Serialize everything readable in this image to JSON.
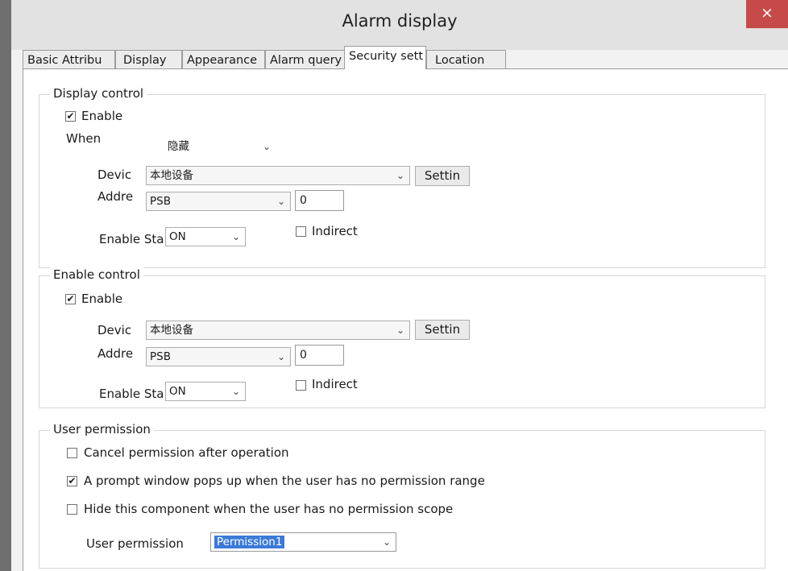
{
  "window": {
    "title": "Alarm display",
    "close_glyph": "×"
  },
  "tabs": [
    "Basic Attribu",
    "Display",
    "Appearance",
    "Alarm query",
    "Security sett",
    "Location"
  ],
  "display_control": {
    "legend": "Display control",
    "enable_label": "Enable",
    "enable_checked": true,
    "when_label": "When",
    "when_value": "隐藏",
    "device_label": "Devic",
    "device_value": "本地设备",
    "settings_button": "Settin",
    "address_label": "Addre",
    "address_type": "PSB",
    "address_value": "0",
    "enable_state_label": "Enable Sta",
    "enable_state_value": "ON",
    "indirect_label": "Indirect",
    "indirect_checked": false
  },
  "enable_control": {
    "legend": "Enable control",
    "enable_label": "Enable",
    "enable_checked": true,
    "device_label": "Devic",
    "device_value": "本地设备",
    "settings_button": "Settin",
    "address_label": "Addre",
    "address_type": "PSB",
    "address_value": "0",
    "enable_state_label": "Enable Sta",
    "enable_state_value": "ON",
    "indirect_label": "Indirect",
    "indirect_checked": false
  },
  "user_permission": {
    "legend": "User permission",
    "option1": "Cancel permission after operation",
    "option1_checked": false,
    "option2": "A prompt window pops up when the user has no permission range",
    "option2_checked": true,
    "option3": "Hide this component when the user has no permission scope",
    "option3_checked": false,
    "permission_label": "User permission",
    "permission_value": "Permission1"
  },
  "icons": {
    "checkmark": "✔",
    "dropdown": "⌄"
  }
}
